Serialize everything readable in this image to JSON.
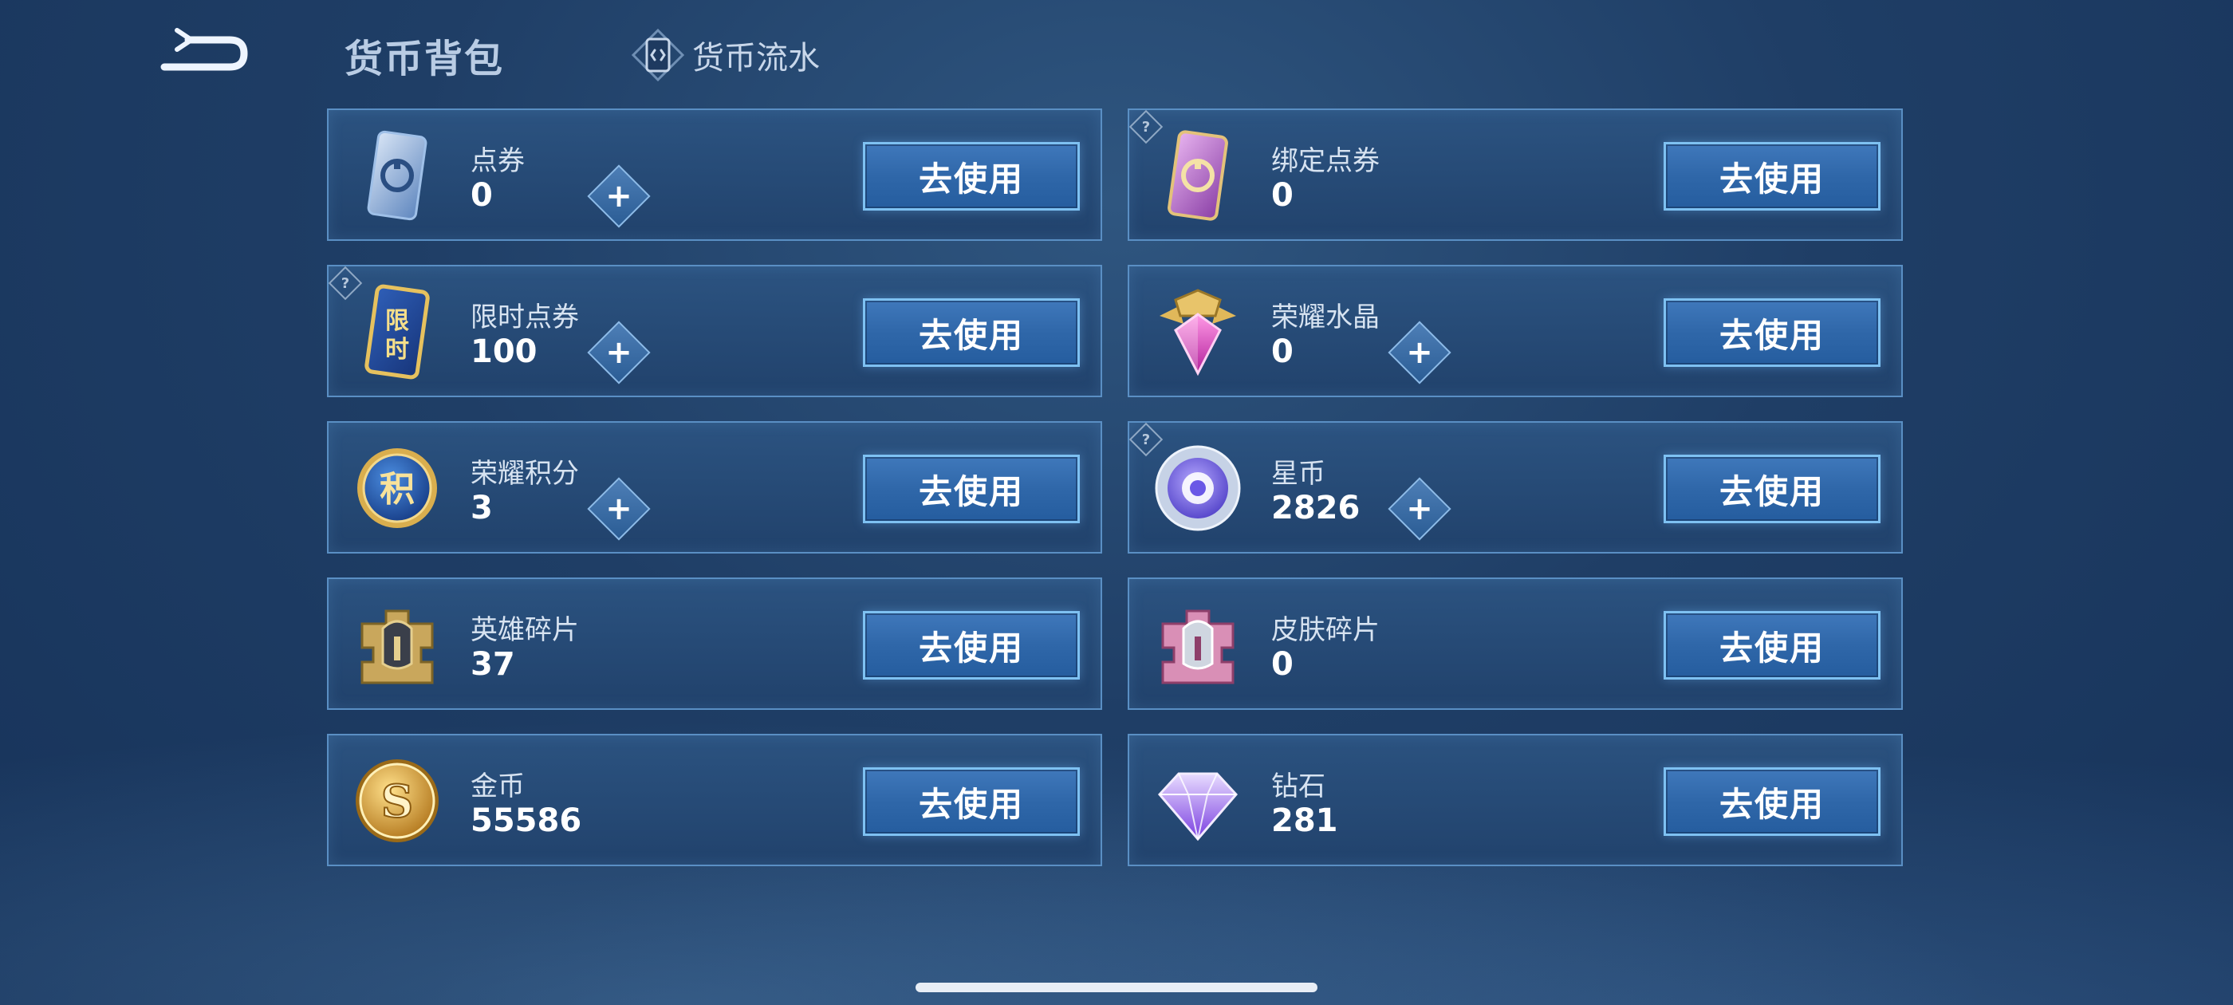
{
  "header": {
    "title": "货币背包",
    "flow_tab_label": "货币流水"
  },
  "use_button_label": "去使用",
  "info_badge_glyph": "?",
  "plus_glyph": "+",
  "currencies": [
    {
      "name": "点券",
      "amount": "0",
      "has_plus": true,
      "has_info": false,
      "icon": "ticket-icon"
    },
    {
      "name": "绑定点券",
      "amount": "0",
      "has_plus": false,
      "has_info": true,
      "icon": "bound-ticket-icon"
    },
    {
      "name": "限时点券",
      "amount": "100",
      "has_plus": true,
      "has_info": true,
      "icon": "limited-ticket-icon",
      "icon_text": "限时"
    },
    {
      "name": "荣耀水晶",
      "amount": "0",
      "has_plus": true,
      "has_info": false,
      "icon": "glory-crystal-icon"
    },
    {
      "name": "荣耀积分",
      "amount": "3",
      "has_plus": true,
      "has_info": false,
      "icon": "glory-points-icon",
      "icon_text": "积"
    },
    {
      "name": "星币",
      "amount": "2826",
      "has_plus": true,
      "has_info": true,
      "icon": "star-coin-icon"
    },
    {
      "name": "英雄碎片",
      "amount": "37",
      "has_plus": false,
      "has_info": false,
      "icon": "hero-fragment-icon"
    },
    {
      "name": "皮肤碎片",
      "amount": "0",
      "has_plus": false,
      "has_info": false,
      "icon": "skin-fragment-icon"
    },
    {
      "name": "金币",
      "amount": "55586",
      "has_plus": false,
      "has_info": false,
      "icon": "gold-coin-icon",
      "icon_text": "S"
    },
    {
      "name": "钻石",
      "amount": "281",
      "has_plus": false,
      "has_info": false,
      "icon": "diamond-icon"
    }
  ]
}
